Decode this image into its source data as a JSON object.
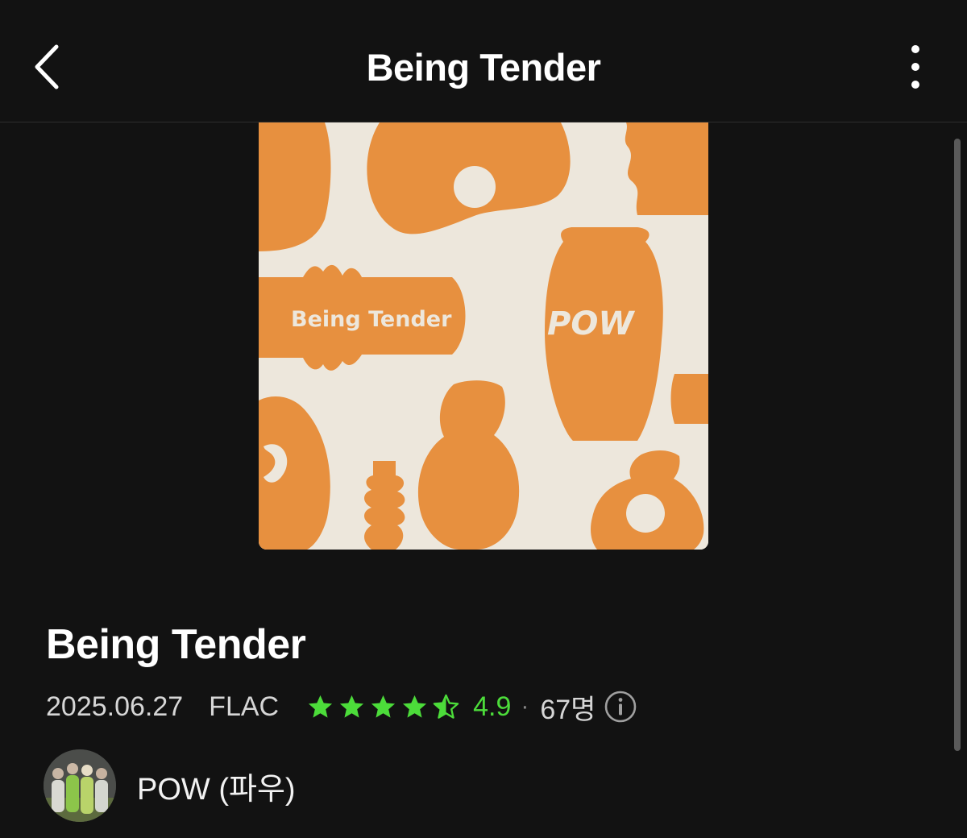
{
  "header": {
    "title": "Being Tender",
    "back_icon": "chevron-left-icon",
    "more_icon": "more-vertical-icon"
  },
  "cover": {
    "art_title": "Being Tender",
    "art_logo": "POW",
    "bg_color": "#ede7dc",
    "shape_color": "#e7903f"
  },
  "album": {
    "title": "Being Tender",
    "release_date": "2025.06.27",
    "format": "FLAC",
    "rating_stars": 4.5,
    "rating_value": "4.9",
    "separator": "·",
    "rating_count": "67명",
    "info_icon": "info-icon",
    "accent_color": "#4cdc3a"
  },
  "artist": {
    "name": "POW (파우)",
    "avatar_icon": "artist-avatar"
  }
}
